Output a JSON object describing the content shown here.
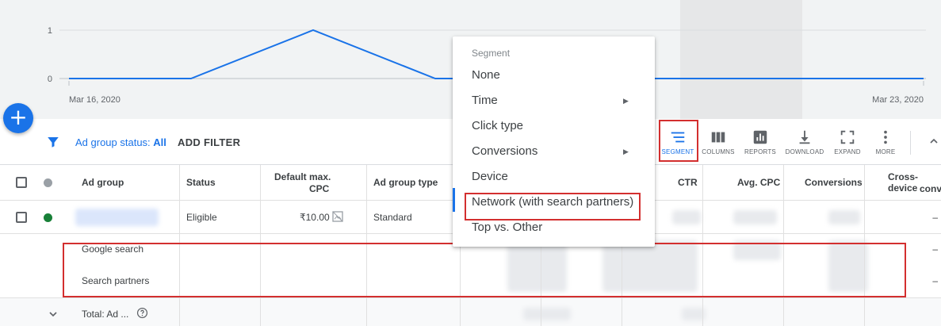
{
  "chart": {
    "y_ticks": [
      "1",
      "0"
    ],
    "x_start": "Mar 16, 2020",
    "x_end": "Mar 23, 2020",
    "line_color": "#1a73e8"
  },
  "chart_data": {
    "type": "line",
    "x": [
      "Mar 16, 2020",
      "Mar 17",
      "Mar 18",
      "Mar 19",
      "Mar 20",
      "Mar 21",
      "Mar 22",
      "Mar 23, 2020"
    ],
    "series": [
      {
        "values": [
          0,
          0,
          1,
          0,
          0,
          0,
          0,
          0
        ]
      }
    ],
    "ylim": [
      0,
      1
    ]
  },
  "fab": {
    "icon": "plus-icon",
    "glyph": "+"
  },
  "filter": {
    "status_label": "Ad group status:",
    "status_value": "All",
    "add_filter": "ADD FILTER"
  },
  "toolbar": {
    "segment": "SEGMENT",
    "columns": "COLUMNS",
    "reports": "REPORTS",
    "download": "DOWNLOAD",
    "expand": "EXPAND",
    "more": "MORE"
  },
  "table": {
    "headers": {
      "ad_group": "Ad group",
      "status": "Status",
      "default_cpc_1": "Default max.",
      "default_cpc_2": "CPC",
      "ad_group_type": "Ad group type",
      "ctr": "CTR",
      "avg_cpc": "Avg. CPC",
      "conversions": "Conversions",
      "cross_device_1": "Cross-device",
      "cross_device_2": "conv."
    },
    "row": {
      "status": "Eligible",
      "cpc": "₹10.00",
      "type": "Standard",
      "dash": "–"
    },
    "segments": [
      "Google search",
      "Search partners"
    ],
    "total_label": "Total: Ad ..."
  },
  "menu": {
    "heading": "Segment",
    "items": [
      "None",
      "Time",
      "Click type",
      "Conversions",
      "Device",
      "Network (with search partners)",
      "Top vs. Other"
    ]
  },
  "colors": {
    "accent": "#1a73e8",
    "highlight": "#d32f2f",
    "eligible": "#188038"
  }
}
